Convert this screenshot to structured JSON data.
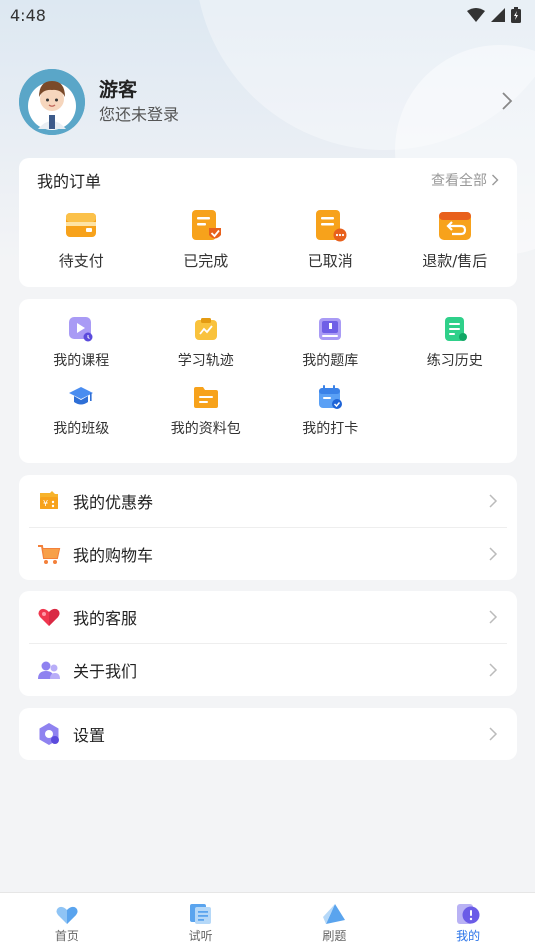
{
  "status_bar": {
    "time": "4:48"
  },
  "profile": {
    "name": "游客",
    "subtitle": "您还未登录"
  },
  "orders": {
    "title": "我的订单",
    "view_all": "查看全部",
    "items": [
      {
        "label": "待支付",
        "icon": "wallet-icon"
      },
      {
        "label": "已完成",
        "icon": "completed-order-icon"
      },
      {
        "label": "已取消",
        "icon": "cancelled-order-icon"
      },
      {
        "label": "退款/售后",
        "icon": "refund-icon"
      }
    ]
  },
  "features": {
    "items": [
      {
        "label": "我的课程",
        "icon": "course-icon"
      },
      {
        "label": "学习轨迹",
        "icon": "study-track-icon"
      },
      {
        "label": "我的题库",
        "icon": "question-bank-icon"
      },
      {
        "label": "练习历史",
        "icon": "practice-history-icon"
      },
      {
        "label": "我的班级",
        "icon": "class-icon"
      },
      {
        "label": "我的资料包",
        "icon": "materials-folder-icon"
      },
      {
        "label": "我的打卡",
        "icon": "check-in-calendar-icon"
      }
    ]
  },
  "menu_group_1": [
    {
      "label": "我的优惠券",
      "icon": "coupon-icon"
    },
    {
      "label": "我的购物车",
      "icon": "cart-icon"
    }
  ],
  "menu_group_2": [
    {
      "label": "我的客服",
      "icon": "heart-service-icon"
    },
    {
      "label": "关于我们",
      "icon": "about-people-icon"
    }
  ],
  "menu_group_3": [
    {
      "label": "设置",
      "icon": "settings-icon"
    }
  ],
  "tabbar": {
    "items": [
      {
        "label": "首页",
        "icon": "home-heart-icon"
      },
      {
        "label": "试听",
        "icon": "audition-icon"
      },
      {
        "label": "刷题",
        "icon": "practice-icon"
      },
      {
        "label": "我的",
        "icon": "profile-icon"
      }
    ],
    "active_index": 3
  },
  "colors": {
    "accent": "#2a73e8",
    "orange": "#f7a21b",
    "background": "#f3f4f6"
  }
}
